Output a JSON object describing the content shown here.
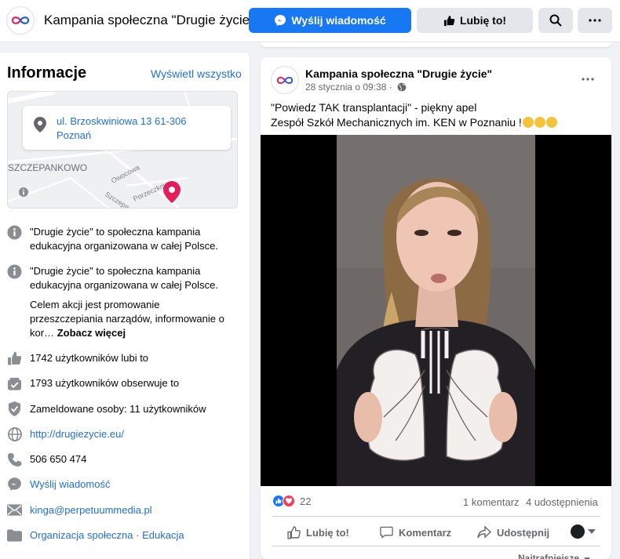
{
  "header": {
    "page_name": "Kampania społeczna \"Drugie życie\"",
    "send_message_label": "Wyślij wiadomość",
    "like_label": "Lubię to!",
    "search_icon": "search-icon",
    "more_icon": "more-icon",
    "accent_color": "#1877f2"
  },
  "info": {
    "heading": "Informacje",
    "see_all": "Wyświetl wszystko",
    "address_line1": "ul. Brzoskwiniowa 13 61-306",
    "address_line2": "Poznań",
    "map_labels": [
      "SZCZEPANKOWO",
      "Owocowa",
      "Porzeczkow",
      "Szczepa"
    ],
    "about_short": "\"Drugie życie\" to społeczna kampania edukacyjna organizowana w całej Polsce.",
    "about_long": "\"Drugie życie\" to społeczna kampania edukacyjna organizowana w całej Polsce.",
    "about_more_text": "Celem akcji jest promowanie przeszczepiania narządów, informowanie o kor…",
    "see_more": "Zobacz więcej",
    "likes": "1742 użytkowników lubi to",
    "followers": "1793 użytkowników obserwuje to",
    "checkins": "Zameldowane osoby: 11 użytkowników",
    "website": "http://drugiezycie.eu/",
    "phone": "506 650 474",
    "message": "Wyślij wiadomość",
    "email": "kinga@perpetuummedia.pl",
    "category_1": "Organizacja społeczna",
    "category_sep": " · ",
    "category_2": "Edukacja"
  },
  "post": {
    "author": "Kampania społeczna \"Drugie życie\"",
    "date": "28 stycznia o 09:38 ·",
    "text_line1": "\"Powiedz TAK transplantacji\" - piękny apel",
    "text_line2": "Zespół Szkół Mechanicznych im. KEN w Poznaniu !",
    "reactions_count": "22",
    "comments": "1 komentarz",
    "shares": "4 udostępnienia",
    "actions": {
      "like": "Lubię to!",
      "comment": "Komentarz",
      "share": "Udostępnij"
    },
    "sort_label": "Najtrafniejsze"
  }
}
